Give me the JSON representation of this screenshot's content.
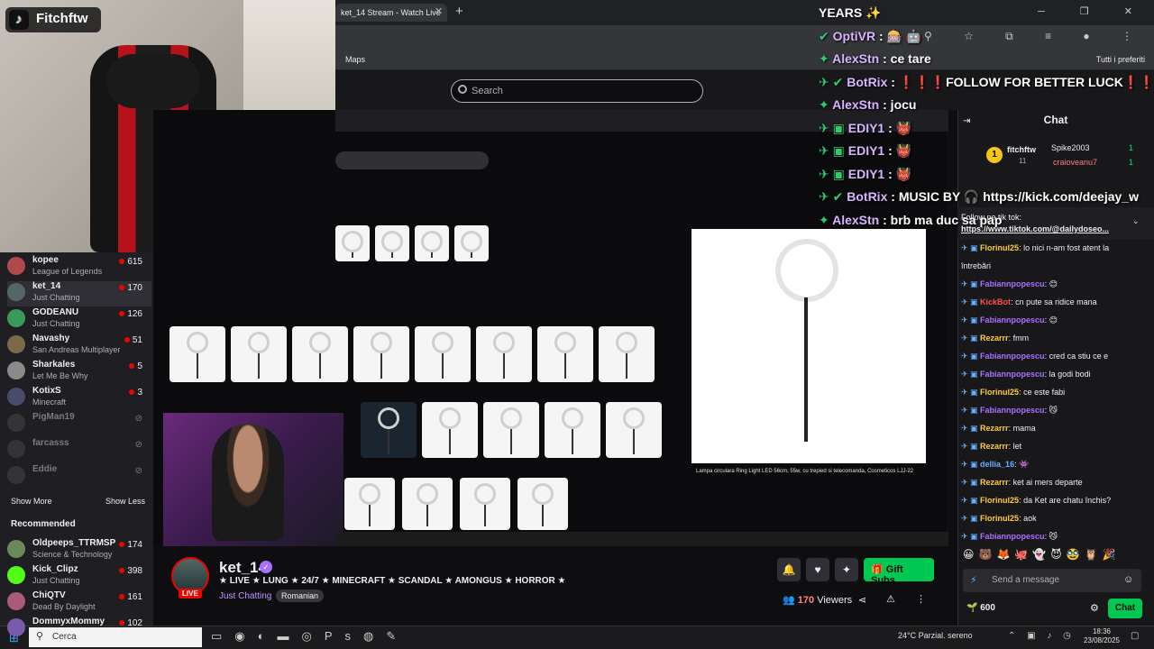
{
  "browser": {
    "tab_title": "ket_14 Stream - Watch Live",
    "bookmark_maps": "Maps",
    "bookmark_all": "Tutti i preferiti"
  },
  "twitch": {
    "search_placeholder": "Search"
  },
  "overlay": {
    "tiktok_name": "Fitchftw"
  },
  "sidebar": {
    "channels": [
      {
        "name": "kopee",
        "game": "League of Legends",
        "viewers": "615",
        "color": "#b04a4a"
      },
      {
        "name": "ket_14",
        "game": "Just Chatting",
        "viewers": "170",
        "color": "#556666"
      },
      {
        "name": "GODEANU",
        "game": "Just Chatting",
        "viewers": "126",
        "color": "#3a9a5a"
      },
      {
        "name": "Navashy",
        "game": "San Andreas Multiplayer",
        "viewers": "51",
        "color": "#7a6a4a"
      },
      {
        "name": "Sharkales",
        "game": "Let Me Be Why",
        "viewers": "5",
        "color": "#8a8a8a"
      },
      {
        "name": "KotixS",
        "game": "Minecraft",
        "viewers": "3",
        "color": "#4a4a6a"
      },
      {
        "name": "PigMan19",
        "game": "",
        "viewers": "",
        "color": "#555555"
      },
      {
        "name": "farcasss",
        "game": "",
        "viewers": "",
        "color": "#555555"
      },
      {
        "name": "Eddie",
        "game": "",
        "viewers": "",
        "color": "#555555"
      }
    ],
    "show_more": "Show More",
    "show_less": "Show Less",
    "recommended_title": "Recommended",
    "recommended": [
      {
        "name": "Oldpeeps_TTRMSP",
        "game": "Science & Technology",
        "viewers": "174",
        "color": "#6a8a5a"
      },
      {
        "name": "Kick_Clipz",
        "game": "Just Chatting",
        "viewers": "398",
        "color": "#53fc18"
      },
      {
        "name": "ChiQTV",
        "game": "Dead By Daylight",
        "viewers": "161",
        "color": "#aa5a7a"
      },
      {
        "name": "DommyxMommy",
        "game": "",
        "viewers": "102",
        "color": "#7a5aaa"
      }
    ]
  },
  "stream_overlay_chat": [
    {
      "badges": "",
      "name": "",
      "text": "YEARS ✨"
    },
    {
      "badges": "✔",
      "name": "OptiVR",
      "text": ": 🎰 🤖"
    },
    {
      "badges": "✦",
      "name": "AlexStn",
      "text": ": ce tare"
    },
    {
      "badges": "✈ ✔",
      "name": "BotRix",
      "text": ": ❗❗❗FOLLOW FOR BETTER LUCK❗❗❗"
    },
    {
      "badges": "✦",
      "name": "AlexStn",
      "text": ": jocu"
    },
    {
      "badges": "✈ ▣",
      "name": "EDIY1",
      "text": ": 👹"
    },
    {
      "badges": "✈ ▣",
      "name": "EDIY1",
      "text": ": 👹"
    },
    {
      "badges": "✈ ▣",
      "name": "EDIY1",
      "text": ": 👹"
    },
    {
      "badges": "✈ ✔",
      "name": "BotRix",
      "text": ": MUSIC BY 🎧 https://kick.com/deejay_w"
    },
    {
      "badges": "✦",
      "name": "AlexStn",
      "text": ": brb ma duc sa pap"
    }
  ],
  "preview": {
    "caption": "Lampa circulara Ring Light LED 56cm, 55w, cu trepied si telecomanda, Cosmeticos LJJ-22"
  },
  "stream_info": {
    "live_label": "LIVE",
    "name": "ket_14",
    "title": "★ LIVE ★ LUNG ★ 24/7 ★ MINECRAFT ★ SCANDAL ★ AMONGUS ★ HORROR ★",
    "category": "Just Chatting",
    "tag": "Romanian",
    "viewers_count": "170",
    "viewers_label": "Viewers",
    "gift_label": "Gift Subs"
  },
  "chat": {
    "title": "Chat",
    "leaderboard": [
      {
        "rank": "1",
        "name": "fitchftw",
        "score": "11"
      },
      {
        "name": "Spike2003",
        "score": "1"
      },
      {
        "name": "craioveanu7",
        "score": "1"
      }
    ],
    "pinned_text": "Follow pe tik tok:",
    "pinned_link": "https://www.tiktok.com/@dailydoseo...",
    "messages": [
      {
        "name": "Florinul25",
        "color": "#ffcc33",
        "text": ": lo nici n-am fost atent la"
      },
      {
        "name": "",
        "color": "#ffcc33",
        "text": "întrebări"
      },
      {
        "name": "Fabiannpopescu",
        "color": "#a970ff",
        "text": ": 😊"
      },
      {
        "name": "KickBot",
        "color": "#ff4d4d",
        "text": ": cn pute sa ridice mana"
      },
      {
        "name": "Fabiannpopescu",
        "color": "#a970ff",
        "text": ": 😊"
      },
      {
        "name": "Rezarrr",
        "color": "#ffcc33",
        "text": ": fmm"
      },
      {
        "name": "Fabiannpopescu",
        "color": "#a970ff",
        "text": ": cred ca stiu ce e"
      },
      {
        "name": "Fabiannpopescu",
        "color": "#a970ff",
        "text": ": la godi bodi"
      },
      {
        "name": "Florinul25",
        "color": "#ffcc33",
        "text": ": ce este fabi"
      },
      {
        "name": "Fabiannpopescu",
        "color": "#a970ff",
        "text": ": 😼"
      },
      {
        "name": "Rezarrr",
        "color": "#ffcc33",
        "text": ": mama"
      },
      {
        "name": "Rezarrr",
        "color": "#ffcc33",
        "text": ": let"
      },
      {
        "name": "dellia_16",
        "color": "#6ab0ff",
        "text": ": 👾"
      },
      {
        "name": "Rezarrr",
        "color": "#ffcc33",
        "text": ": ket ai mers departe"
      },
      {
        "name": "Florinul25",
        "color": "#ffcc33",
        "text": ": da Ket are chatu închis?"
      },
      {
        "name": "Florinul25",
        "color": "#ffcc33",
        "text": ": aok"
      },
      {
        "name": "Fabiannpopescu",
        "color": "#a970ff",
        "text": ": 😼"
      }
    ],
    "input_placeholder": "Send a message",
    "points": "600",
    "send_label": "Chat"
  },
  "taskbar": {
    "search_placeholder": "Cerca",
    "weather": "24°C  Parzial. sereno",
    "time": "18:36",
    "date": "23/08/2025"
  }
}
